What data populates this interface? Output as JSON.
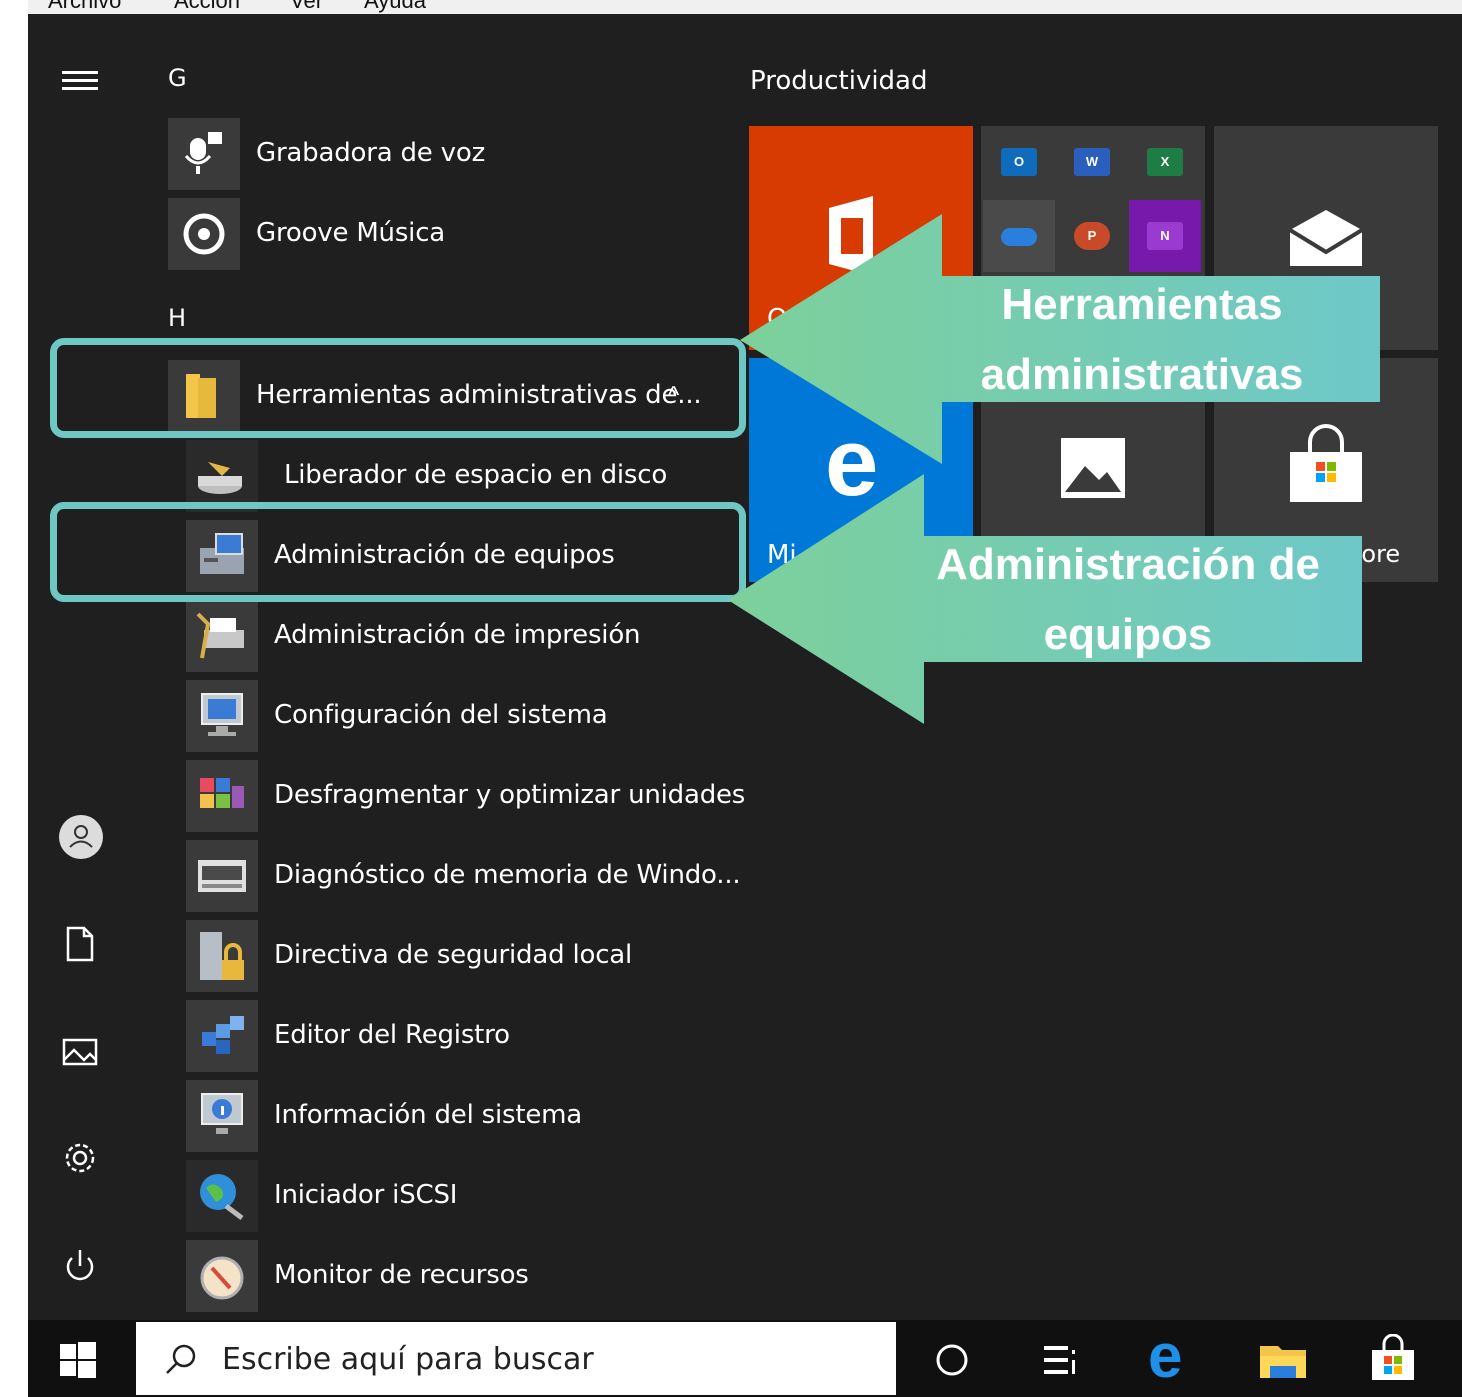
{
  "menubar": {
    "items": [
      "Archivo",
      "Acción",
      "Ver",
      "Ayuda"
    ]
  },
  "left_rail": {
    "icons": [
      "hamburger-icon",
      "user-icon",
      "document-icon",
      "pictures-icon",
      "settings-icon",
      "power-icon"
    ]
  },
  "app_list": {
    "group_g": "G",
    "group_h": "H",
    "grabadora": "Grabadora de voz",
    "groove": "Groove Música",
    "herramientas_folder": "Herramientas administrativas de...",
    "chevron": "^",
    "items": [
      "Liberador de espacio en disco",
      "Administración de equipos",
      "Administración de impresión",
      "Configuración del sistema",
      "Desfragmentar y optimizar unidades",
      "Diagnóstico de memoria de Windo...",
      "Directiva de seguridad local",
      "Editor del Registro",
      "Información del sistema",
      "Iniciador iSCSI",
      "Monitor de recursos"
    ]
  },
  "tiles": {
    "group_title": "Productividad",
    "edge_label_partial": "Mi",
    "store_label_partial": "tore",
    "office_label_partial": "O",
    "office_colors": {
      "office": "#d83b01",
      "edge": "#0078d7",
      "tile": "#3a3a3a",
      "onenote": "#7719aa"
    }
  },
  "annotations": {
    "herramientas": "Herramientas administrativas",
    "administracion": "Administración de equipos",
    "highlight_color": "#6fc7c4",
    "arrow_gradient_start": "#7dd09a",
    "arrow_gradient_end": "#6ec8c8"
  },
  "taskbar": {
    "search_placeholder": "Escribe aquí para buscar",
    "icons": [
      "windows-start-icon",
      "search-icon",
      "cortana-icon",
      "task-view-icon",
      "edge-icon",
      "file-explorer-icon",
      "store-icon"
    ]
  }
}
